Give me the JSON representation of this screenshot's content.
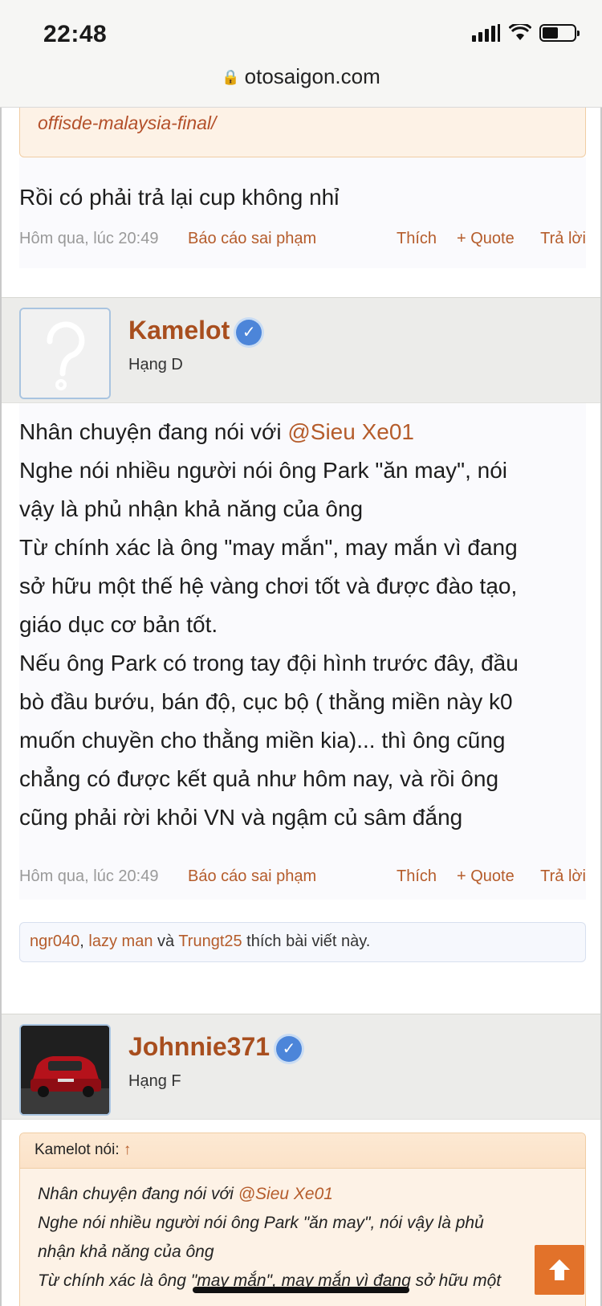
{
  "status_bar": {
    "time": "22:48"
  },
  "browser": {
    "url": "otosaigon.com"
  },
  "prev_post": {
    "quote_link_tail": "offisde-malaysia-final/",
    "message": "Rồi có phải trả lại cup không nhỉ",
    "meta": {
      "date": "Hôm qua, lúc 20:49",
      "report": "Báo cáo sai phạm",
      "like": "Thích",
      "quote": "+ Quote",
      "reply": "Trả lời"
    }
  },
  "post_kamelot": {
    "username": "Kamelot",
    "rank": "Hạng D",
    "verified_icon": "check",
    "mention_prefix": "Nhân chuyện đang nói với ",
    "mention": "@Sieu Xe01",
    "lines": [
      "Nghe nói nhiều người nói ông Park \"ăn may\", nói",
      "vậy là phủ nhận khả năng của ông",
      "Từ chính xác là ông \"may mắn\", may mắn vì đang",
      "sở hữu một thế hệ vàng chơi tốt và được đào tạo,",
      "giáo dục cơ bản tốt.",
      "Nếu ông Park có trong tay đội hình trước đây, đầu",
      "bò đầu bướu, bán độ, cục bộ ( thằng miền này k0",
      "muốn chuyền cho thằng miền kia)... thì ông cũng",
      "chẳng có được kết quả như hôm nay, và rồi ông",
      "cũng phải rời khỏi VN và ngậm củ sâm đắng"
    ],
    "meta": {
      "date": "Hôm qua, lúc 20:49",
      "report": "Báo cáo sai phạm",
      "like": "Thích",
      "quote": "+ Quote",
      "reply": "Trả lời"
    },
    "likes": {
      "user1": "ngr040",
      "sep1": ", ",
      "user2": "lazy man",
      "and": " và ",
      "user3": "Trungt25",
      "suffix": " thích bài viết này."
    }
  },
  "post_johnnie": {
    "username": "Johnnie371",
    "rank": "Hạng F",
    "quote": {
      "author_label": "Kamelot nói: ",
      "arrow": "↑",
      "mention_prefix": "Nhân chuyện đang nói với ",
      "mention": "@Sieu Xe01",
      "lines": [
        "Nghe nói nhiều người nói ông Park \"ăn may\", nói vậy là phủ",
        "nhận khả năng của ông",
        "Từ chính xác là ông \"may mắn\", may mắn vì đang sở hữu một"
      ]
    }
  },
  "colors": {
    "accent": "#b55c2b",
    "username": "#a84e1e",
    "scroll_button": "#e2722a",
    "verified": "#4c85d9"
  },
  "icons": {
    "scroll_top": "arrow-up-icon",
    "lock": "lock-icon"
  }
}
